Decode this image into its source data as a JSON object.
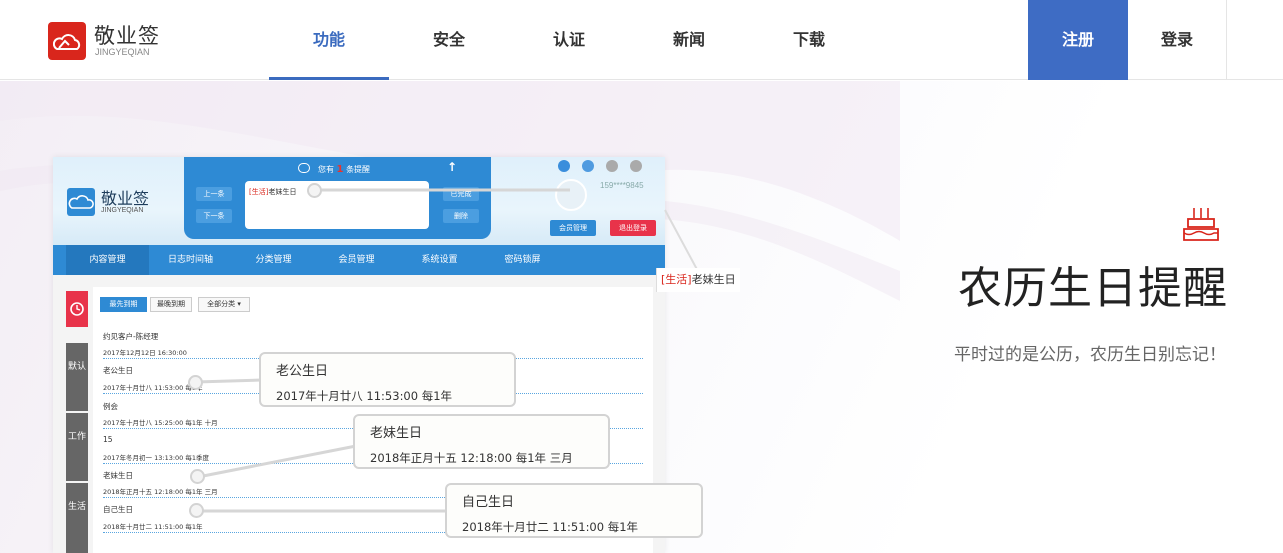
{
  "brand": {
    "name_cn": "敬业签",
    "name_en": "JINGYEQIAN"
  },
  "nav": {
    "items": [
      {
        "label": "功能",
        "active": true
      },
      {
        "label": "安全",
        "active": false
      },
      {
        "label": "认证",
        "active": false
      },
      {
        "label": "新闻",
        "active": false
      },
      {
        "label": "下载",
        "active": false
      }
    ],
    "register_label": "注册",
    "login_label": "登录"
  },
  "app": {
    "logo_cn": "敬业签",
    "logo_en": "JINGYEQIAN",
    "reminder": {
      "prefix": "您有",
      "count": "1",
      "suffix": "条提醒",
      "tag": "[生活]",
      "text": "老妹生日",
      "prev_label": "上一条",
      "next_label": "下一条",
      "done_label": "已完成",
      "delete_label": "删除"
    },
    "phone": "159****9845",
    "member_label": "会员管理",
    "logout_label": "退出登录",
    "menu": [
      "内容管理",
      "日志时间轴",
      "分类管理",
      "会员管理",
      "系统设置",
      "密码锁屏"
    ],
    "side_tabs": [
      "默认",
      "工作",
      "生活"
    ],
    "filters": [
      "最先到期",
      "最晚到期",
      "全部分类 ▾"
    ],
    "entries": [
      {
        "title": "约见客户-陈经理",
        "meta": "2017年12月12日 16:30:00"
      },
      {
        "title": "老公生日",
        "meta": "2017年十月廿八 11:53:00 每1年"
      },
      {
        "title": "例会",
        "meta": "2017年十月廿八 15:25:00 每1年 十月"
      },
      {
        "title": "15",
        "meta": "2017年冬月初一 13:13:00 每1季度"
      },
      {
        "title": "老妹生日",
        "meta": "2018年正月十五 12:18:00 每1年 三月"
      },
      {
        "title": "自己生日",
        "meta": "2018年十月廿二 11:51:00 每1年"
      }
    ]
  },
  "callouts": [
    {
      "title": "老公生日",
      "sub": "2017年十月廿八 11:53:00 每1年"
    },
    {
      "title": "老妹生日",
      "sub": "2018年正月十五 12:18:00 每1年 三月"
    },
    {
      "title": "自己生日",
      "sub": "2018年十月廿二 11:51:00 每1年"
    }
  ],
  "floating_reminder": {
    "tag": "[生活]",
    "text": "老妹生日"
  },
  "hero": {
    "title": "农历生日提醒",
    "subtitle": "平时过的是公历，农历生日别忘记！"
  },
  "colors": {
    "accent": "#3e6cc4",
    "brand_red": "#d9261c",
    "app_blue": "#2e8ad4"
  }
}
